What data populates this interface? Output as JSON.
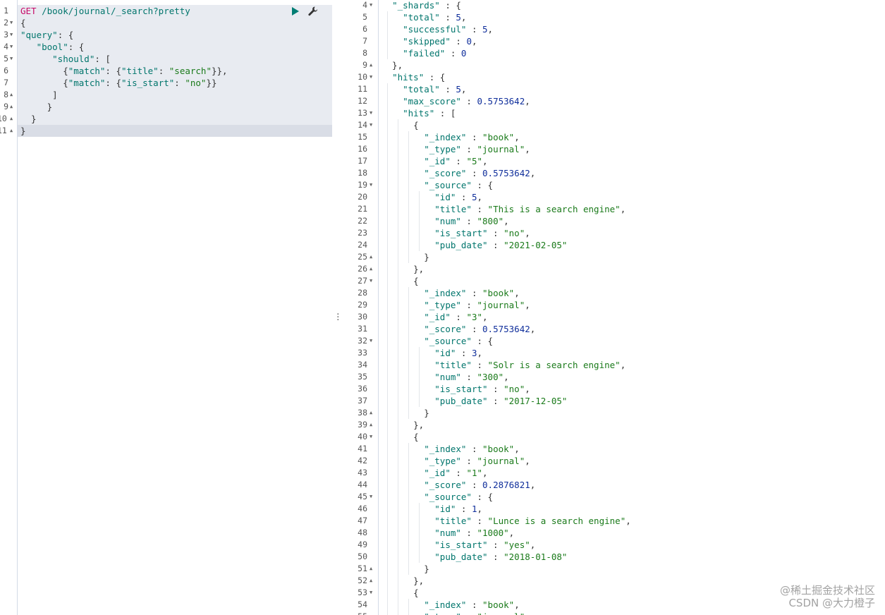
{
  "request": {
    "method": "GET",
    "url": "/book/journal/_search?pretty",
    "lines": [
      {
        "num": "1",
        "fold": false,
        "text": ""
      },
      {
        "num": "2",
        "fold": true,
        "text": "{"
      },
      {
        "num": "3",
        "fold": true,
        "text": "\"query\": {"
      },
      {
        "num": "4",
        "fold": true,
        "text": "   \"bool\": {"
      },
      {
        "num": "5",
        "fold": true,
        "text": "      \"should\": ["
      },
      {
        "num": "6",
        "fold": false,
        "text": "        {\"match\": {\"title\": \"search\"}},"
      },
      {
        "num": "7",
        "fold": false,
        "text": "        {\"match\": {\"is_start\": \"no\"}}"
      },
      {
        "num": "8",
        "fold": true,
        "text": "      ]"
      },
      {
        "num": "9",
        "fold": true,
        "text": "     }"
      },
      {
        "num": "10",
        "fold": true,
        "text": "  }"
      },
      {
        "num": "11",
        "fold": true,
        "text": "}"
      }
    ]
  },
  "toolbar": {
    "run_icon": "play-icon",
    "settings_icon": "wrench-icon"
  },
  "response": {
    "lines": [
      {
        "num": "4",
        "fold": true,
        "text": "  \"_shards\" : {"
      },
      {
        "num": "5",
        "fold": false,
        "text": "    \"total\" : 5,"
      },
      {
        "num": "6",
        "fold": false,
        "text": "    \"successful\" : 5,"
      },
      {
        "num": "7",
        "fold": false,
        "text": "    \"skipped\" : 0,"
      },
      {
        "num": "8",
        "fold": false,
        "text": "    \"failed\" : 0"
      },
      {
        "num": "9",
        "fold": true,
        "text": "  },"
      },
      {
        "num": "10",
        "fold": true,
        "text": "  \"hits\" : {"
      },
      {
        "num": "11",
        "fold": false,
        "text": "    \"total\" : 5,"
      },
      {
        "num": "12",
        "fold": false,
        "text": "    \"max_score\" : 0.5753642,"
      },
      {
        "num": "13",
        "fold": true,
        "text": "    \"hits\" : ["
      },
      {
        "num": "14",
        "fold": true,
        "text": "      {"
      },
      {
        "num": "15",
        "fold": false,
        "text": "        \"_index\" : \"book\","
      },
      {
        "num": "16",
        "fold": false,
        "text": "        \"_type\" : \"journal\","
      },
      {
        "num": "17",
        "fold": false,
        "text": "        \"_id\" : \"5\","
      },
      {
        "num": "18",
        "fold": false,
        "text": "        \"_score\" : 0.5753642,"
      },
      {
        "num": "19",
        "fold": true,
        "text": "        \"_source\" : {"
      },
      {
        "num": "20",
        "fold": false,
        "text": "          \"id\" : 5,"
      },
      {
        "num": "21",
        "fold": false,
        "text": "          \"title\" : \"This is a search engine\","
      },
      {
        "num": "22",
        "fold": false,
        "text": "          \"num\" : \"800\","
      },
      {
        "num": "23",
        "fold": false,
        "text": "          \"is_start\" : \"no\","
      },
      {
        "num": "24",
        "fold": false,
        "text": "          \"pub_date\" : \"2021-02-05\""
      },
      {
        "num": "25",
        "fold": true,
        "text": "        }"
      },
      {
        "num": "26",
        "fold": true,
        "text": "      },"
      },
      {
        "num": "27",
        "fold": true,
        "text": "      {"
      },
      {
        "num": "28",
        "fold": false,
        "text": "        \"_index\" : \"book\","
      },
      {
        "num": "29",
        "fold": false,
        "text": "        \"_type\" : \"journal\","
      },
      {
        "num": "30",
        "fold": false,
        "text": "        \"_id\" : \"3\","
      },
      {
        "num": "31",
        "fold": false,
        "text": "        \"_score\" : 0.5753642,"
      },
      {
        "num": "32",
        "fold": true,
        "text": "        \"_source\" : {"
      },
      {
        "num": "33",
        "fold": false,
        "text": "          \"id\" : 3,"
      },
      {
        "num": "34",
        "fold": false,
        "text": "          \"title\" : \"Solr is a search engine\","
      },
      {
        "num": "35",
        "fold": false,
        "text": "          \"num\" : \"300\","
      },
      {
        "num": "36",
        "fold": false,
        "text": "          \"is_start\" : \"no\","
      },
      {
        "num": "37",
        "fold": false,
        "text": "          \"pub_date\" : \"2017-12-05\""
      },
      {
        "num": "38",
        "fold": true,
        "text": "        }"
      },
      {
        "num": "39",
        "fold": true,
        "text": "      },"
      },
      {
        "num": "40",
        "fold": true,
        "text": "      {"
      },
      {
        "num": "41",
        "fold": false,
        "text": "        \"_index\" : \"book\","
      },
      {
        "num": "42",
        "fold": false,
        "text": "        \"_type\" : \"journal\","
      },
      {
        "num": "43",
        "fold": false,
        "text": "        \"_id\" : \"1\","
      },
      {
        "num": "44",
        "fold": false,
        "text": "        \"_score\" : 0.2876821,"
      },
      {
        "num": "45",
        "fold": true,
        "text": "        \"_source\" : {"
      },
      {
        "num": "46",
        "fold": false,
        "text": "          \"id\" : 1,"
      },
      {
        "num": "47",
        "fold": false,
        "text": "          \"title\" : \"Lunce is a search engine\","
      },
      {
        "num": "48",
        "fold": false,
        "text": "          \"num\" : \"1000\","
      },
      {
        "num": "49",
        "fold": false,
        "text": "          \"is_start\" : \"yes\","
      },
      {
        "num": "50",
        "fold": false,
        "text": "          \"pub_date\" : \"2018-01-08\""
      },
      {
        "num": "51",
        "fold": true,
        "text": "        }"
      },
      {
        "num": "52",
        "fold": true,
        "text": "      },"
      },
      {
        "num": "53",
        "fold": true,
        "text": "      {"
      },
      {
        "num": "54",
        "fold": false,
        "text": "        \"_index\" : \"book\","
      },
      {
        "num": "55",
        "fold": false,
        "text": "        \"_type\" : \"journal\","
      }
    ]
  },
  "watermark": {
    "line1": "@稀土掘金技术社区",
    "line2": "CSDN @大力橙子"
  }
}
